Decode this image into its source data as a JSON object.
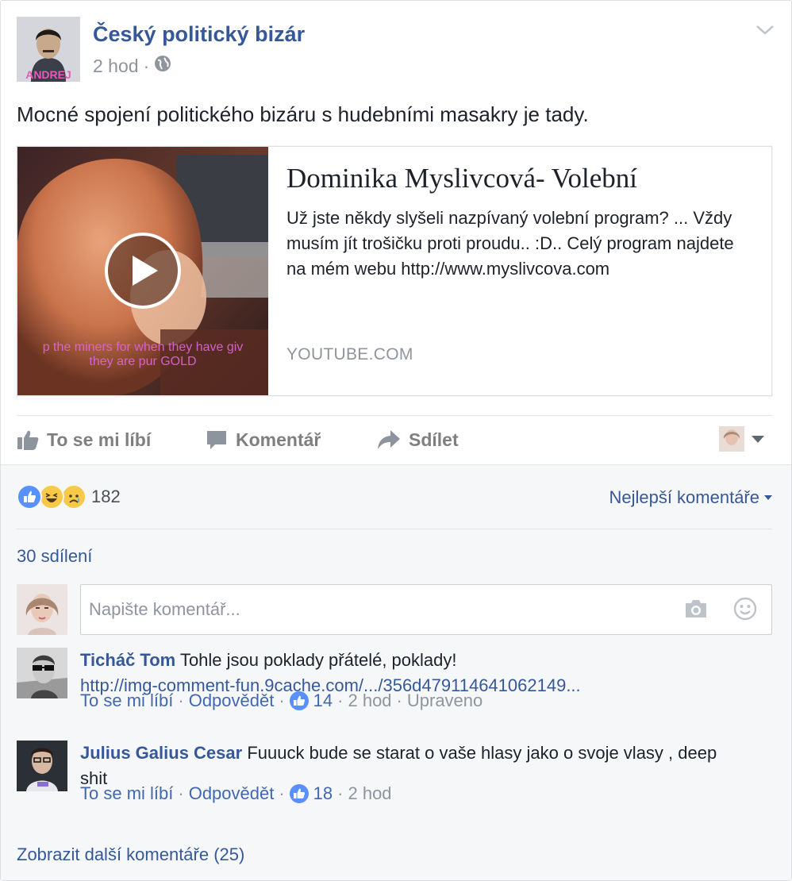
{
  "post": {
    "page_name": "Český politický bizár",
    "time": "2 hod",
    "meta_sep": "·",
    "avatar_text": "ANDREJ",
    "text": "Mocné spojení politického bizáru s hudebními masakry je tady."
  },
  "preview": {
    "title": "Dominika Myslivcová- Volební",
    "description": "Už jste někdy slyšeli nazpívaný volební program? ... Vždy musím jít trošičku proti proudu.. :D.. Celý program najdete na mém webu http://www.myslivcova.com",
    "domain": "YOUTUBE.COM",
    "thumb_caption_1": "p the miners for when they have giv",
    "thumb_caption_2": "they are pur GOLD"
  },
  "actions": {
    "like": "To se mi líbí",
    "comment": "Komentář",
    "share": "Sdílet"
  },
  "feedback": {
    "reaction_count": "182",
    "sort_label": "Nejlepší komentáře",
    "shares": "30 sdílení",
    "comment_placeholder": "Napište komentář..."
  },
  "comments": [
    {
      "author": "Ticháč Tom",
      "text": "Tohle jsou poklady přátelé, poklady!",
      "link": "http://img-comment-fun.9cache.com/.../356d479114641062149...",
      "like": "To se mi líbí",
      "reply": "Odpovědět",
      "likes": "14",
      "time": "2 hod",
      "edited": "Upraveno"
    },
    {
      "author": "Julius Galius Cesar",
      "text": "Fuuuck bude se starat o vaše hlasy jako o svoje vlasy , deep shit",
      "like": "To se mi líbí",
      "reply": "Odpovědět",
      "likes": "18",
      "time": "2 hod"
    }
  ],
  "more_comments": "Zobrazit další komentáře (25)",
  "colors": {
    "link": "#365899",
    "meta": "#90949c",
    "like_blue": "#5890ff",
    "feedback_bg": "#f6f7f9"
  },
  "icons": [
    "globe-icon",
    "chevron-down-icon",
    "play-icon",
    "thumbs-up-icon",
    "comment-icon",
    "share-icon",
    "caret-down-icon",
    "camera-icon",
    "smiley-icon",
    "like-reaction-icon",
    "haha-reaction-icon",
    "sad-reaction-icon"
  ]
}
